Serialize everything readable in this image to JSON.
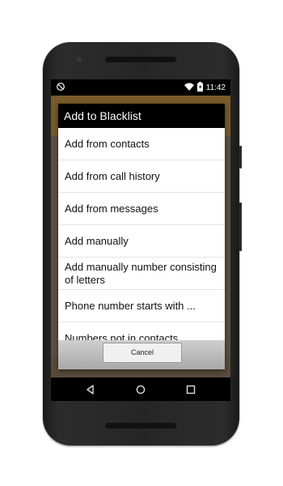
{
  "status_bar": {
    "time": "11:42",
    "icons": [
      "blocked-icon",
      "wifi-icon",
      "battery-icon"
    ]
  },
  "dialog": {
    "title": "Add to Blacklist",
    "items": [
      {
        "label": "Add from contacts"
      },
      {
        "label": "Add from call history"
      },
      {
        "label": "Add from messages"
      },
      {
        "label": "Add manually"
      },
      {
        "label": "Add manually number consisting of letters"
      },
      {
        "label": "Phone number starts with ..."
      },
      {
        "label": "Numbers not in contacts"
      }
    ],
    "cancel_label": "Cancel"
  },
  "nav_bar": {
    "buttons": [
      "back-icon",
      "home-icon",
      "recents-icon"
    ]
  },
  "colors": {
    "dialog_title_bg": "#000000",
    "dialog_bg": "#ffffff",
    "app_toolbar": "#7a5b2a"
  }
}
